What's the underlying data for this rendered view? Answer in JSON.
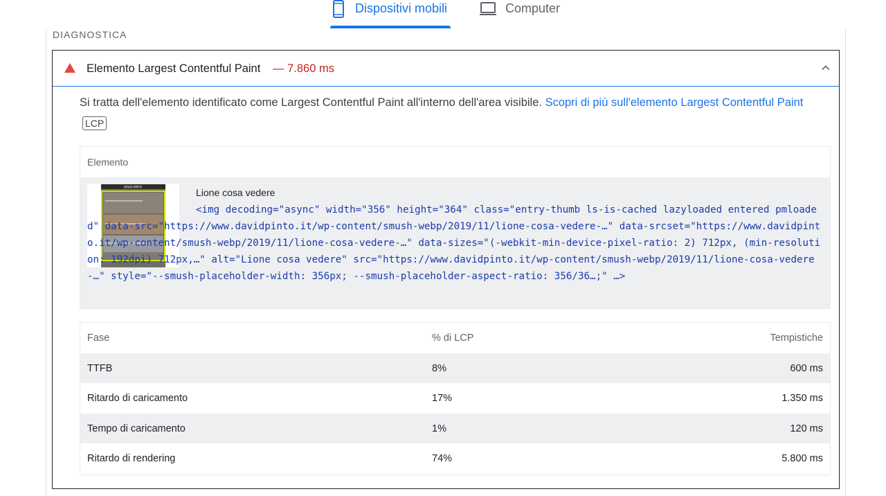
{
  "tabs": {
    "mobile_label": "Dispositivi mobili",
    "desktop_label": "Computer"
  },
  "section": {
    "title": "DIAGNOSTICA"
  },
  "audit": {
    "title": "Elemento Largest Contentful Paint",
    "value": "— 7.860 ms",
    "status_color": "#e8453c",
    "description_text": "Si tratta dell'elemento identificato come Largest Contentful Paint all'interno dell'area visibile.",
    "learn_more_link": "Scopri di più sull'elemento Largest Contentful Paint",
    "badge": "LCP"
  },
  "element_table": {
    "header": "Elemento",
    "node_label": "Lione cosa vedere",
    "snippet": "<img decoding=\"async\" width=\"356\" height=\"364\" class=\"entry-thumb ls-is-cached lazyloaded entered pmloaded\" data-src=\"https://www.davidpinto.it/wp-content/smush-webp/2019/11/lione-cosa-vedere-…\" data-srcset=\"https://www.davidpinto.it/wp-content/smush-webp/2019/11/lione-cosa-vedere-…\" data-sizes=\"(-webkit-min-device-pixel-ratio: 2) 712px, (min-resolution: 192dpi) 712px,…\" alt=\"Lione cosa vedere\" src=\"https://www.davidpinto.it/wp-content/smush-webp/2019/11/lione-cosa-vedere-…\" style=\"--smush-placeholder-width: 356px; --smush-placeholder-aspect-ratio: 356/36…;\" …>",
    "thumbnail": {
      "site_name": "DAVID PINTO"
    }
  },
  "phase_table": {
    "headers": {
      "phase": "Fase",
      "pct": "% di LCP",
      "time": "Tempistiche"
    },
    "rows": [
      {
        "phase": "TTFB",
        "pct": "8%",
        "time": "600 ms"
      },
      {
        "phase": "Ritardo di caricamento",
        "pct": "17%",
        "time": "1.350 ms"
      },
      {
        "phase": "Tempo di caricamento",
        "pct": "1%",
        "time": "120 ms"
      },
      {
        "phase": "Ritardo di rendering",
        "pct": "74%",
        "time": "5.800 ms"
      }
    ]
  },
  "colors": {
    "accent": "#1a73e8",
    "fail": "#c5221f",
    "code": "#1a3caa"
  }
}
